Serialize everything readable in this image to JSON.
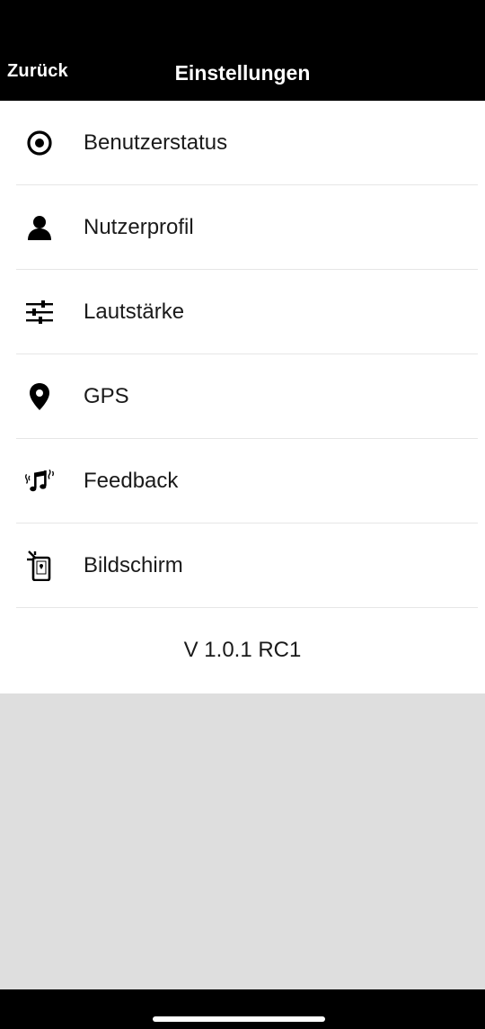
{
  "header": {
    "back_label": "Zurück",
    "title": "Einstellungen"
  },
  "menu": {
    "items": [
      {
        "label": "Benutzerstatus",
        "icon": "target-icon"
      },
      {
        "label": "Nutzerprofil",
        "icon": "person-icon"
      },
      {
        "label": "Lautstärke",
        "icon": "sliders-icon"
      },
      {
        "label": "GPS",
        "icon": "location-pin-icon"
      },
      {
        "label": "Feedback",
        "icon": "music-vibration-icon"
      },
      {
        "label": "Bildschirm",
        "icon": "phone-screen-icon"
      }
    ]
  },
  "footer": {
    "version": "V 1.0.1 RC1"
  },
  "colors": {
    "bar": "#000000",
    "background": "#ffffff",
    "empty_area": "#dedede",
    "separator": "#e6e6e6"
  }
}
